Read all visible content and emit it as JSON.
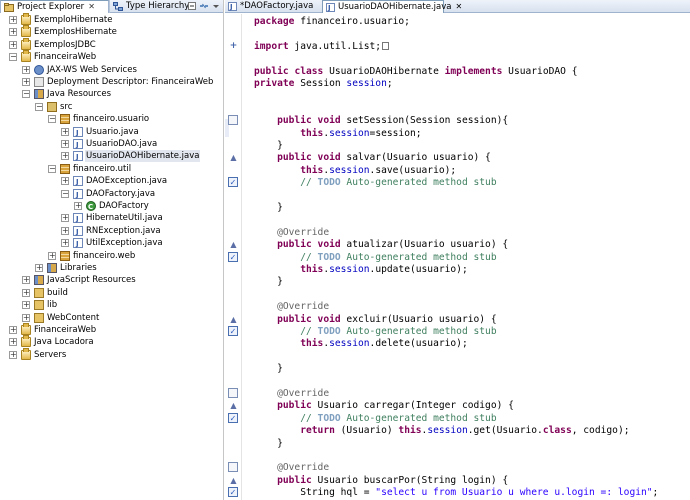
{
  "explorer": {
    "tabs": [
      {
        "label": "Project Explorer",
        "close": "✕",
        "icon": "package-explorer-icon"
      },
      {
        "label": "Type Hierarchy",
        "icon": "type-hierarchy-icon"
      }
    ],
    "toolbar_icons": [
      "collapse-all-icon",
      "link-with-editor-icon",
      "view-menu-icon"
    ],
    "tree": [
      {
        "label": "ExemploHibernate",
        "depth": 0,
        "toggle": "+",
        "icon": "project"
      },
      {
        "label": "ExemplosHibernate",
        "depth": 0,
        "toggle": "+",
        "icon": "project"
      },
      {
        "label": "ExemplosJDBC",
        "depth": 0,
        "toggle": "+",
        "icon": "project"
      },
      {
        "label": "FinanceiraWeb",
        "depth": 0,
        "toggle": "−",
        "icon": "project"
      },
      {
        "label": "JAX-WS Web Services",
        "depth": 1,
        "toggle": "+",
        "icon": "ws"
      },
      {
        "label": "Deployment Descriptor: FinanceiraWeb",
        "depth": 1,
        "toggle": "+",
        "icon": "dd"
      },
      {
        "label": "Java Resources",
        "depth": 1,
        "toggle": "−",
        "icon": "lib"
      },
      {
        "label": "src",
        "depth": 2,
        "toggle": "−",
        "icon": "src"
      },
      {
        "label": "financeiro.usuario",
        "depth": 3,
        "toggle": "−",
        "icon": "pkg"
      },
      {
        "label": "Usuario.java",
        "depth": 4,
        "toggle": "+",
        "icon": "java"
      },
      {
        "label": "UsuarioDAO.java",
        "depth": 4,
        "toggle": "+",
        "icon": "java"
      },
      {
        "label": "UsuarioDAOHibernate.java",
        "depth": 4,
        "toggle": "+",
        "icon": "java",
        "selected": true
      },
      {
        "label": "financeiro.util",
        "depth": 3,
        "toggle": "−",
        "icon": "pkg"
      },
      {
        "label": "DAOException.java",
        "depth": 4,
        "toggle": "+",
        "icon": "java"
      },
      {
        "label": "DAOFactory.java",
        "depth": 4,
        "toggle": "−",
        "icon": "java"
      },
      {
        "label": "DAOFactory",
        "depth": 5,
        "toggle": "+",
        "icon": "class"
      },
      {
        "label": "HibernateUtil.java",
        "depth": 4,
        "toggle": "+",
        "icon": "java"
      },
      {
        "label": "RNException.java",
        "depth": 4,
        "toggle": "+",
        "icon": "java"
      },
      {
        "label": "UtilException.java",
        "depth": 4,
        "toggle": "+",
        "icon": "java"
      },
      {
        "label": "financeiro.web",
        "depth": 3,
        "toggle": "+",
        "icon": "pkg"
      },
      {
        "label": "Libraries",
        "depth": 2,
        "toggle": "+",
        "icon": "lib"
      },
      {
        "label": "JavaScript Resources",
        "depth": 1,
        "toggle": "+",
        "icon": "lib"
      },
      {
        "label": "build",
        "depth": 1,
        "toggle": "+",
        "icon": "folder"
      },
      {
        "label": "lib",
        "depth": 1,
        "toggle": "+",
        "icon": "folder"
      },
      {
        "label": "WebContent",
        "depth": 1,
        "toggle": "+",
        "icon": "folder"
      },
      {
        "label": "FinanceiraWeb",
        "depth": 0,
        "toggle": "+",
        "icon": "project"
      },
      {
        "label": "Java Locadora",
        "depth": 0,
        "toggle": "+",
        "icon": "project"
      },
      {
        "label": "Servers",
        "depth": 0,
        "toggle": "+",
        "icon": "project"
      }
    ]
  },
  "editor": {
    "tabs": [
      {
        "label": "*DAOFactory.java",
        "active": false
      },
      {
        "label": "UsuarioDAOHibernate.java",
        "active": true,
        "close": "✕"
      }
    ],
    "lines": [
      [
        {
          "t": "kw",
          "v": "package"
        },
        {
          "t": "",
          "v": " financeiro.usuario;"
        }
      ],
      [],
      [
        {
          "t": "kw",
          "v": "import"
        },
        {
          "t": "",
          "v": " java.util.List;"
        },
        {
          "t": "box",
          "v": ""
        }
      ],
      [],
      [
        {
          "t": "kw",
          "v": "public"
        },
        {
          "t": "",
          "v": " "
        },
        {
          "t": "kw",
          "v": "class"
        },
        {
          "t": "",
          "v": " UsuarioDAOHibernate "
        },
        {
          "t": "kw",
          "v": "implements"
        },
        {
          "t": "",
          "v": " UsuarioDAO {"
        }
      ],
      [
        {
          "t": "kw",
          "v": "private"
        },
        {
          "t": "",
          "v": " Session "
        },
        {
          "t": "fld",
          "v": "session"
        },
        {
          "t": "",
          "v": ";"
        }
      ],
      [],
      [],
      [
        {
          "t": "",
          "v": "    "
        },
        {
          "t": "kw",
          "v": "public"
        },
        {
          "t": "",
          "v": " "
        },
        {
          "t": "kw",
          "v": "void"
        },
        {
          "t": "",
          "v": " setSession(Session session){"
        }
      ],
      [
        {
          "t": "",
          "v": "        "
        },
        {
          "t": "kw",
          "v": "this"
        },
        {
          "t": "",
          "v": "."
        },
        {
          "t": "fld",
          "v": "session"
        },
        {
          "t": "",
          "v": "=session;"
        }
      ],
      [
        {
          "t": "",
          "v": "    }"
        }
      ],
      [
        {
          "t": "",
          "v": "    "
        },
        {
          "t": "kw",
          "v": "public"
        },
        {
          "t": "",
          "v": " "
        },
        {
          "t": "kw",
          "v": "void"
        },
        {
          "t": "",
          "v": " salvar(Usuario usuario) {"
        }
      ],
      [
        {
          "t": "",
          "v": "        "
        },
        {
          "t": "kw",
          "v": "this"
        },
        {
          "t": "",
          "v": "."
        },
        {
          "t": "fld",
          "v": "session"
        },
        {
          "t": "",
          "v": ".save(usuario);"
        }
      ],
      [
        {
          "t": "",
          "v": "        "
        },
        {
          "t": "cmt",
          "v": "// "
        },
        {
          "t": "todo",
          "v": "TODO"
        },
        {
          "t": "cmt",
          "v": " Auto-generated method stub"
        }
      ],
      [],
      [
        {
          "t": "",
          "v": "    }"
        }
      ],
      [],
      [
        {
          "t": "",
          "v": "    "
        },
        {
          "t": "ann",
          "v": "@Override"
        }
      ],
      [
        {
          "t": "",
          "v": "    "
        },
        {
          "t": "kw",
          "v": "public"
        },
        {
          "t": "",
          "v": " "
        },
        {
          "t": "kw",
          "v": "void"
        },
        {
          "t": "",
          "v": " atualizar(Usuario usuario) {"
        }
      ],
      [
        {
          "t": "",
          "v": "        "
        },
        {
          "t": "cmt",
          "v": "// "
        },
        {
          "t": "todo",
          "v": "TODO"
        },
        {
          "t": "cmt",
          "v": " Auto-generated method stub"
        }
      ],
      [
        {
          "t": "",
          "v": "        "
        },
        {
          "t": "kw",
          "v": "this"
        },
        {
          "t": "",
          "v": "."
        },
        {
          "t": "fld",
          "v": "session"
        },
        {
          "t": "",
          "v": ".update(usuario);"
        }
      ],
      [
        {
          "t": "",
          "v": "    }"
        }
      ],
      [],
      [
        {
          "t": "",
          "v": "    "
        },
        {
          "t": "ann",
          "v": "@Override"
        }
      ],
      [
        {
          "t": "",
          "v": "    "
        },
        {
          "t": "kw",
          "v": "public"
        },
        {
          "t": "",
          "v": " "
        },
        {
          "t": "kw",
          "v": "void"
        },
        {
          "t": "",
          "v": " excluir(Usuario usuario) {"
        }
      ],
      [
        {
          "t": "",
          "v": "        "
        },
        {
          "t": "cmt",
          "v": "// "
        },
        {
          "t": "todo",
          "v": "TODO"
        },
        {
          "t": "cmt",
          "v": " Auto-generated method stub"
        }
      ],
      [
        {
          "t": "",
          "v": "        "
        },
        {
          "t": "kw",
          "v": "this"
        },
        {
          "t": "",
          "v": "."
        },
        {
          "t": "fld",
          "v": "session"
        },
        {
          "t": "",
          "v": ".delete(usuario);"
        }
      ],
      [],
      [
        {
          "t": "",
          "v": "    }"
        }
      ],
      [],
      [
        {
          "t": "",
          "v": "    "
        },
        {
          "t": "ann",
          "v": "@Override"
        }
      ],
      [
        {
          "t": "",
          "v": "    "
        },
        {
          "t": "kw",
          "v": "public"
        },
        {
          "t": "",
          "v": " Usuario carregar(Integer codigo) {"
        }
      ],
      [
        {
          "t": "",
          "v": "        "
        },
        {
          "t": "cmt",
          "v": "// "
        },
        {
          "t": "todo",
          "v": "TODO"
        },
        {
          "t": "cmt",
          "v": " Auto-generated method stub"
        }
      ],
      [
        {
          "t": "",
          "v": "        "
        },
        {
          "t": "kw",
          "v": "return"
        },
        {
          "t": "",
          "v": " (Usuario) "
        },
        {
          "t": "kw",
          "v": "this"
        },
        {
          "t": "",
          "v": "."
        },
        {
          "t": "fld",
          "v": "session"
        },
        {
          "t": "",
          "v": ".get(Usuario."
        },
        {
          "t": "kw",
          "v": "class"
        },
        {
          "t": "",
          "v": ", codigo);"
        }
      ],
      [
        {
          "t": "",
          "v": "    }"
        }
      ],
      [],
      [
        {
          "t": "",
          "v": "    "
        },
        {
          "t": "ann",
          "v": "@Override"
        }
      ],
      [
        {
          "t": "",
          "v": "    "
        },
        {
          "t": "kw",
          "v": "public"
        },
        {
          "t": "",
          "v": " Usuario buscarPor(String login) {"
        }
      ],
      [
        {
          "t": "",
          "v": "        String hql = "
        },
        {
          "t": "str",
          "v": "\"select u from Usuario u where u.login =: login\""
        },
        {
          "t": "",
          "v": ";"
        }
      ]
    ],
    "markers": [
      {
        "line": 2,
        "kind": "plus",
        "glyph": "+"
      },
      {
        "line": 8,
        "kind": "overview",
        "glyph": ""
      },
      {
        "line": 11,
        "kind": "tri",
        "glyph": "▲"
      },
      {
        "line": 13,
        "kind": "check",
        "glyph": "✓"
      },
      {
        "line": 18,
        "kind": "tri",
        "glyph": "▲"
      },
      {
        "line": 19,
        "kind": "check",
        "glyph": "✓"
      },
      {
        "line": 24,
        "kind": "tri",
        "glyph": "▲"
      },
      {
        "line": 25,
        "kind": "check",
        "glyph": "✓"
      },
      {
        "line": 30,
        "kind": "overview",
        "glyph": ""
      },
      {
        "line": 31,
        "kind": "tri",
        "glyph": "▲"
      },
      {
        "line": 32,
        "kind": "check",
        "glyph": "✓"
      },
      {
        "line": 36,
        "kind": "overview",
        "glyph": ""
      },
      {
        "line": 37,
        "kind": "tri",
        "glyph": "▲"
      },
      {
        "line": 38,
        "kind": "check",
        "glyph": "✓"
      }
    ]
  }
}
